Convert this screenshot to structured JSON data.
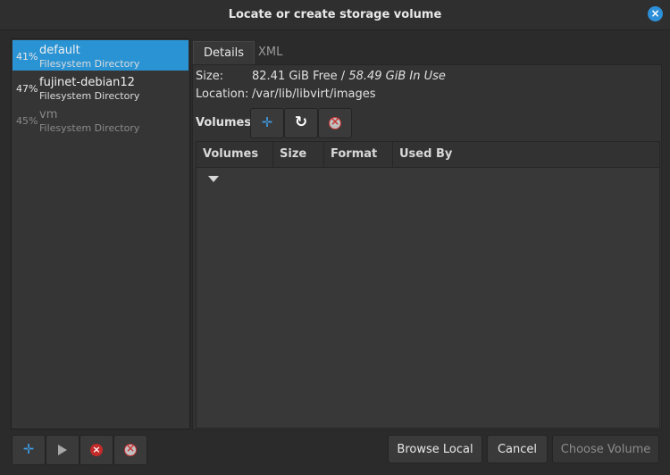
{
  "window": {
    "title": "Locate or create storage volume",
    "close_icon": "close-icon"
  },
  "pools": [
    {
      "percent": "41%",
      "name": "default",
      "type": "Filesystem Directory",
      "selected": true
    },
    {
      "percent": "47%",
      "name": "fujinet-debian12",
      "type": "Filesystem Directory",
      "selected": false
    },
    {
      "percent": "45%",
      "name": "vm",
      "type": "Filesystem Directory",
      "selected": false,
      "inactive": true
    }
  ],
  "tabs": [
    {
      "label": "Details",
      "active": true
    },
    {
      "label": "XML",
      "active": false
    }
  ],
  "details": {
    "size_label": "Size:",
    "size_free": "82.41 GiB Free",
    "size_sep": " / ",
    "size_in_use": "58.49 GiB In Use",
    "location_label": "Location:",
    "location_value": "/var/lib/libvirt/images"
  },
  "volumes": {
    "label": "Volumes",
    "toolbar_icons": [
      "add-icon",
      "refresh-icon",
      "stop-icon"
    ],
    "columns": [
      "Volumes",
      "Size",
      "Format",
      "Used By"
    ],
    "sort_column": "Volumes",
    "rows": []
  },
  "pool_toolbar_icons": [
    "add-icon",
    "play-icon",
    "delete-icon",
    "stop-icon"
  ],
  "buttons": {
    "browse_local": "Browse Local",
    "cancel": "Cancel",
    "choose_volume": "Choose Volume"
  },
  "colors": {
    "selection": "#2a93d4",
    "accent_blue": "#3f9fe8",
    "danger_red": "#c42a2a"
  }
}
